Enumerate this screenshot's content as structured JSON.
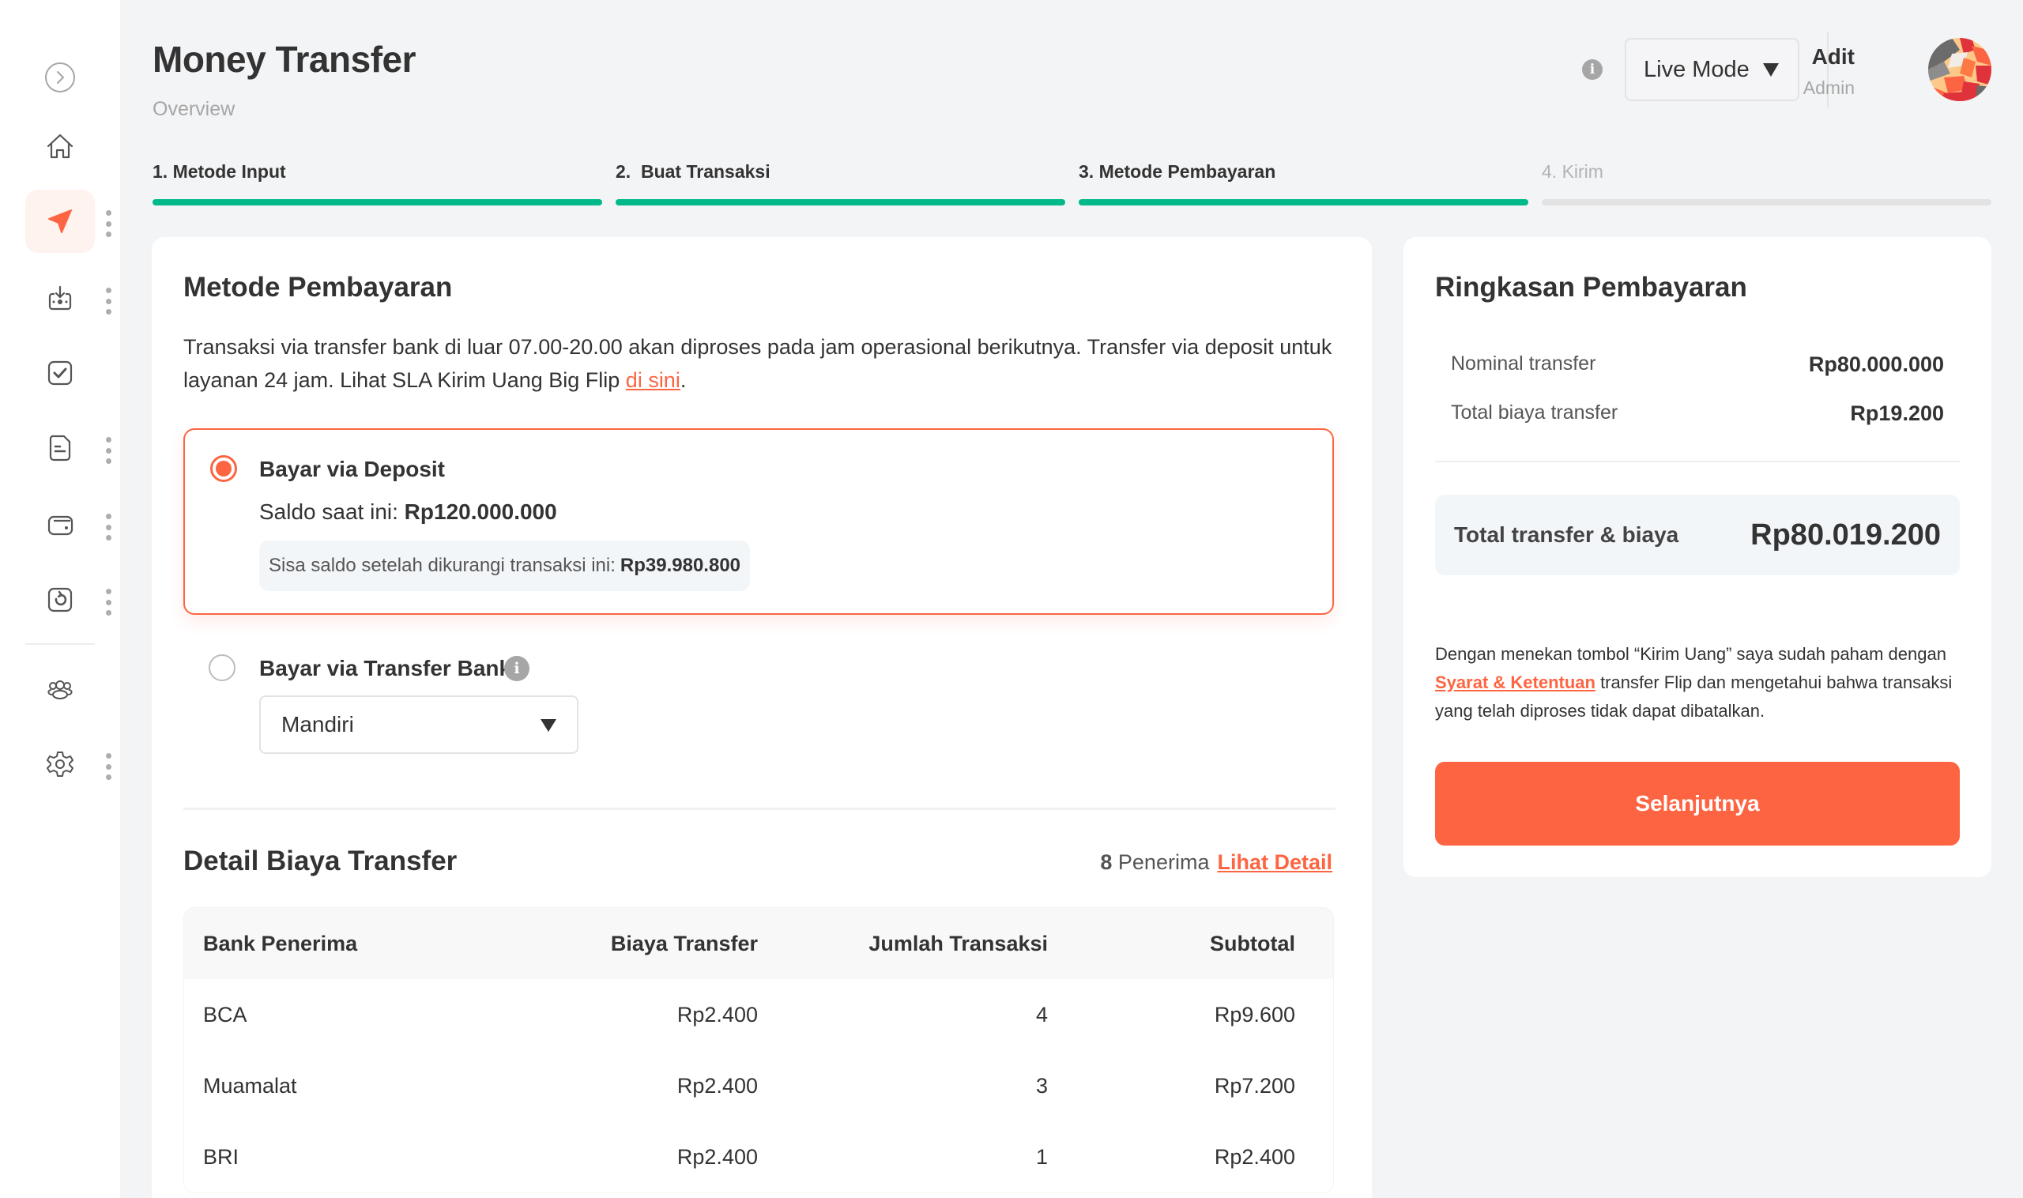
{
  "sidebar": {
    "items": [
      {
        "name": "expand",
        "icon": "chevron-right-circle-icon",
        "has_menu": false,
        "active": false
      },
      {
        "name": "home",
        "icon": "home-icon",
        "has_menu": false,
        "active": false
      },
      {
        "name": "money-transfer",
        "icon": "send-icon",
        "has_menu": true,
        "active": true
      },
      {
        "name": "receive",
        "icon": "inbox-download-icon",
        "has_menu": true,
        "active": false
      },
      {
        "name": "approval",
        "icon": "checkbox-icon",
        "has_menu": false,
        "active": false
      },
      {
        "name": "reports",
        "icon": "document-icon",
        "has_menu": true,
        "active": false
      },
      {
        "name": "wallet",
        "icon": "wallet-icon",
        "has_menu": true,
        "active": false
      },
      {
        "name": "refund",
        "icon": "refresh-icon",
        "has_menu": true,
        "active": false
      },
      {
        "name": "users",
        "icon": "users-icon",
        "has_menu": false,
        "active": false
      },
      {
        "name": "settings",
        "icon": "gear-icon",
        "has_menu": true,
        "active": false
      }
    ]
  },
  "header": {
    "title": "Money Transfer",
    "subtitle": "Overview",
    "mode_select": "Live Mode",
    "user_name": "Adit",
    "user_role": "Admin"
  },
  "steps": [
    {
      "label": "1. Metode Input",
      "complete": true
    },
    {
      "label": "2.  Buat Transaksi",
      "complete": true
    },
    {
      "label": "3. Metode Pembayaran",
      "complete": true
    },
    {
      "label": "4. Kirim",
      "complete": false
    }
  ],
  "payment_method": {
    "title": "Metode Pembayaran",
    "description": "Transaksi via transfer bank di luar 07.00-20.00 akan diproses pada jam operasional berikutnya. Transfer via deposit untuk layanan 24 jam. Lihat SLA Kirim Uang Big Flip ",
    "description_link": "di sini",
    "description_end": ".",
    "deposit": {
      "label": "Bayar via Deposit",
      "selected": true,
      "balance_label": "Saldo saat ini: ",
      "balance_value": "Rp120.000.000",
      "remaining_label": "Sisa saldo setelah dikurangi transaksi ini:",
      "remaining_value": "Rp39.980.800"
    },
    "bank_transfer": {
      "label": "Bayar via Transfer Bank",
      "selected": false,
      "bank_selected": "Mandiri"
    }
  },
  "fee_detail": {
    "title": "Detail Biaya Transfer",
    "recipient_count": "8",
    "recipient_label": "Penerima",
    "view_detail_link": "Lihat Detail",
    "columns": [
      "Bank Penerima",
      "Biaya Transfer",
      "Jumlah Transaksi",
      "Subtotal"
    ],
    "rows": [
      [
        "BCA",
        "Rp2.400",
        "4",
        "Rp9.600"
      ],
      [
        "Muamalat",
        "Rp2.400",
        "3",
        "Rp7.200"
      ],
      [
        "BRI",
        "Rp2.400",
        "1",
        "Rp2.400"
      ]
    ]
  },
  "summary": {
    "title": "Ringkasan Pembayaran",
    "nominal_label": "Nominal transfer",
    "nominal_value": "Rp80.000.000",
    "fee_label": "Total biaya transfer",
    "fee_value": "Rp19.200",
    "total_label": "Total transfer & biaya",
    "total_value": "Rp80.019.200",
    "terms_pre": "Dengan menekan tombol “Kirim Uang” saya sudah paham dengan ",
    "terms_link": "Syarat & Ketentuan",
    "terms_post": " transfer Flip dan mengetahui bahwa transaksi yang telah diproses tidak dapat dibatalkan.",
    "cta": "Selanjutnya"
  },
  "colors": {
    "accent": "#fd6542",
    "progress": "#00b98a",
    "background": "#f3f4f6"
  }
}
